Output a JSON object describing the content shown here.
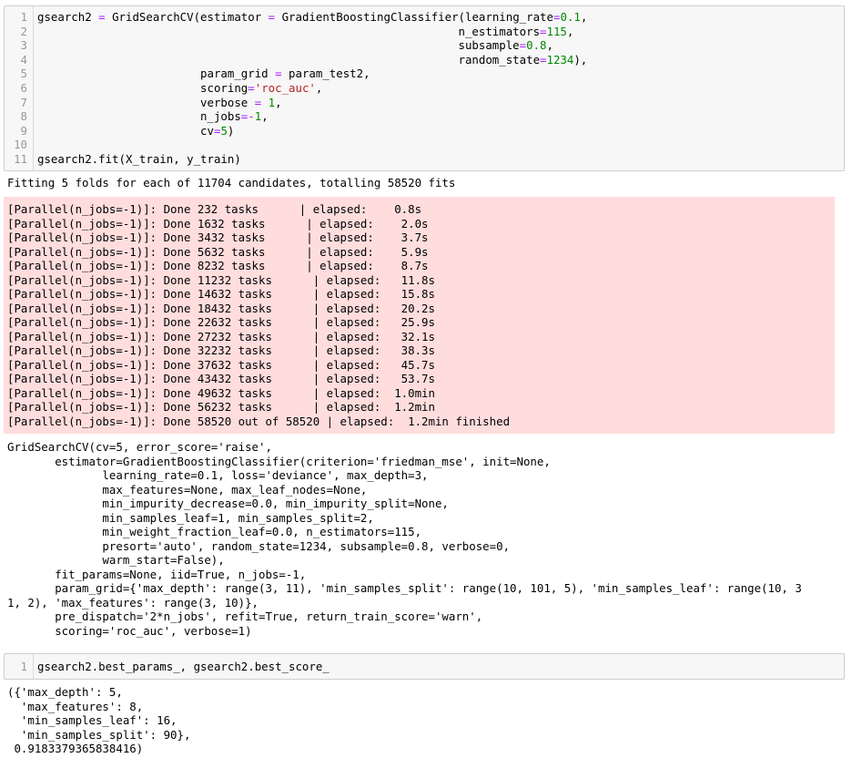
{
  "cell1": {
    "line_numbers": [
      "1",
      "2",
      "3",
      "4",
      "5",
      "6",
      "7",
      "8",
      "9",
      "10",
      "11"
    ],
    "lines": [
      "gsearch2 = GridSearchCV(estimator = GradientBoostingClassifier(learning_rate=0.1,",
      "                                                              n_estimators=115,",
      "                                                              subsample=0.8,",
      "                                                              random_state=1234),",
      "                        param_grid = param_test2,",
      "                        scoring='roc_auc',",
      "                        verbose = 1,",
      "                        n_jobs=-1,",
      "                        cv=5)",
      "",
      "gsearch2.fit(X_train, y_train)"
    ]
  },
  "stdout1": "Fitting 5 folds for each of 11704 candidates, totalling 58520 fits",
  "stderr1": [
    "[Parallel(n_jobs=-1)]: Done 232 tasks      | elapsed:    0.8s",
    "[Parallel(n_jobs=-1)]: Done 1632 tasks      | elapsed:    2.0s",
    "[Parallel(n_jobs=-1)]: Done 3432 tasks      | elapsed:    3.7s",
    "[Parallel(n_jobs=-1)]: Done 5632 tasks      | elapsed:    5.9s",
    "[Parallel(n_jobs=-1)]: Done 8232 tasks      | elapsed:    8.7s",
    "[Parallel(n_jobs=-1)]: Done 11232 tasks      | elapsed:   11.8s",
    "[Parallel(n_jobs=-1)]: Done 14632 tasks      | elapsed:   15.8s",
    "[Parallel(n_jobs=-1)]: Done 18432 tasks      | elapsed:   20.2s",
    "[Parallel(n_jobs=-1)]: Done 22632 tasks      | elapsed:   25.9s",
    "[Parallel(n_jobs=-1)]: Done 27232 tasks      | elapsed:   32.1s",
    "[Parallel(n_jobs=-1)]: Done 32232 tasks      | elapsed:   38.3s",
    "[Parallel(n_jobs=-1)]: Done 37632 tasks      | elapsed:   45.7s",
    "[Parallel(n_jobs=-1)]: Done 43432 tasks      | elapsed:   53.7s",
    "[Parallel(n_jobs=-1)]: Done 49632 tasks      | elapsed:  1.0min",
    "[Parallel(n_jobs=-1)]: Done 56232 tasks      | elapsed:  1.2min",
    "[Parallel(n_jobs=-1)]: Done 58520 out of 58520 | elapsed:  1.2min finished"
  ],
  "result1": "GridSearchCV(cv=5, error_score='raise',\n       estimator=GradientBoostingClassifier(criterion='friedman_mse', init=None,\n              learning_rate=0.1, loss='deviance', max_depth=3,\n              max_features=None, max_leaf_nodes=None,\n              min_impurity_decrease=0.0, min_impurity_split=None,\n              min_samples_leaf=1, min_samples_split=2,\n              min_weight_fraction_leaf=0.0, n_estimators=115,\n              presort='auto', random_state=1234, subsample=0.8, verbose=0,\n              warm_start=False),\n       fit_params=None, iid=True, n_jobs=-1,\n       param_grid={'max_depth': range(3, 11), 'min_samples_split': range(10, 101, 5), 'min_samples_leaf': range(10, 3\n1, 2), 'max_features': range(3, 10)},\n       pre_dispatch='2*n_jobs', refit=True, return_train_score='warn',\n       scoring='roc_auc', verbose=1)",
  "cell2": {
    "line_numbers": [
      "1"
    ],
    "lines": [
      "gsearch2.best_params_, gsearch2.best_score_"
    ]
  },
  "result2": "({'max_depth': 5,\n  'max_features': 8,\n  'min_samples_leaf': 16,\n  'min_samples_split': 90},\n 0.9183379365838416)",
  "colors": {
    "input_bg": "#f7f7f7",
    "stderr_bg": "#ffdddd",
    "number": "#008800",
    "string": "#ba2121",
    "operator": "#aa22ff"
  }
}
